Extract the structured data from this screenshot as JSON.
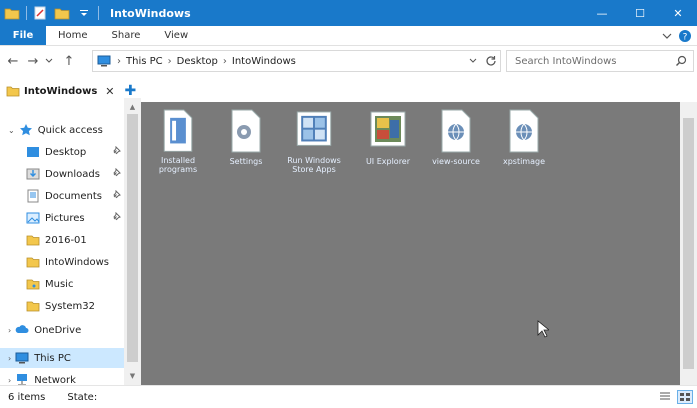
{
  "window": {
    "title": "IntoWindows",
    "qat_icons": [
      "folder-icon",
      "properties-icon",
      "new-folder-icon",
      "qat-dropdown-icon"
    ],
    "minimize_glyph": "—",
    "maximize_glyph": "☐",
    "close_glyph": "✕"
  },
  "ribbon": {
    "tabs": [
      {
        "label": "File"
      },
      {
        "label": "Home"
      },
      {
        "label": "Share"
      },
      {
        "label": "View"
      }
    ],
    "expand_glyph": "⌄",
    "help_glyph": "?"
  },
  "address": {
    "back": "←",
    "forward": "→",
    "recent": "⌄",
    "up": "↑",
    "crumbs": [
      "This PC",
      "Desktop",
      "IntoWindows"
    ],
    "separator": "›",
    "dropdown": "⌄",
    "refresh": "↻"
  },
  "search": {
    "placeholder": "Search IntoWindows"
  },
  "navpane": {
    "tab_label": "IntoWindows",
    "close": "✕",
    "add": "✚",
    "quick_access": "Quick access",
    "items": [
      {
        "label": "Desktop",
        "pinned": true
      },
      {
        "label": "Downloads",
        "pinned": true
      },
      {
        "label": "Documents",
        "pinned": true
      },
      {
        "label": "Pictures",
        "pinned": true
      },
      {
        "label": "2016-01",
        "pinned": false
      },
      {
        "label": "IntoWindows",
        "pinned": false
      },
      {
        "label": "Music",
        "pinned": false
      },
      {
        "label": "System32",
        "pinned": false
      }
    ],
    "onedrive": "OneDrive",
    "thispc": "This PC",
    "network": "Network",
    "pin_glyph": "📌"
  },
  "files": [
    {
      "label": "Installed programs"
    },
    {
      "label": "Settings"
    },
    {
      "label": "Run Windows Store Apps"
    },
    {
      "label": "UI Explorer"
    },
    {
      "label": "view-source"
    },
    {
      "label": "xpstimage"
    }
  ],
  "status": {
    "count": "6 items",
    "state": "State:"
  },
  "colors": {
    "accent": "#1979ca",
    "content_bg": "#7a7a7a",
    "selected_bg": "#cce8ff"
  }
}
